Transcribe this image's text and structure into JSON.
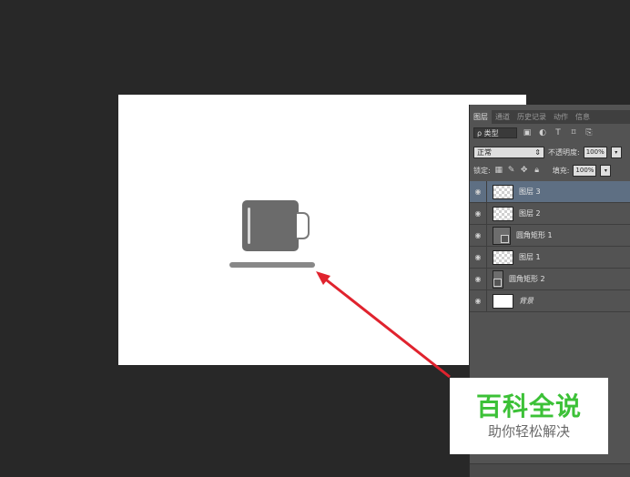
{
  "panel": {
    "tabs": [
      "图层",
      "通道",
      "历史记录",
      "动作",
      "信息"
    ],
    "filter_label": "ρ 类型",
    "filter_icons": [
      "image-filter-icon",
      "adjustment-filter-icon",
      "type-filter-icon",
      "shape-filter-icon",
      "smart-object-filter-icon"
    ],
    "blend_mode": "正常",
    "opacity_label": "不透明度:",
    "opacity_value": "100%",
    "lock_label": "锁定:",
    "fill_label": "填充:",
    "fill_value": "100%",
    "layers": [
      {
        "name": "图层 3",
        "thumb": "transparent",
        "selected": true
      },
      {
        "name": "图层 2",
        "thumb": "transparent",
        "selected": false
      },
      {
        "name": "圆角矩形 1",
        "thumb": "shape",
        "selected": false
      },
      {
        "name": "图层 1",
        "thumb": "transparent",
        "selected": false
      },
      {
        "name": "圆角矩形 2",
        "thumb": "shape",
        "selected": false
      },
      {
        "name": "背景",
        "thumb": "white",
        "selected": false
      }
    ]
  },
  "watermark": {
    "title": "百科全说",
    "subtitle": "助你轻松解决"
  },
  "colors": {
    "app_background": "#282828",
    "panel_background": "#535353",
    "selected_layer": "#5e6f83",
    "arrow": "#e0232e",
    "watermark_green": "#3cc137"
  }
}
